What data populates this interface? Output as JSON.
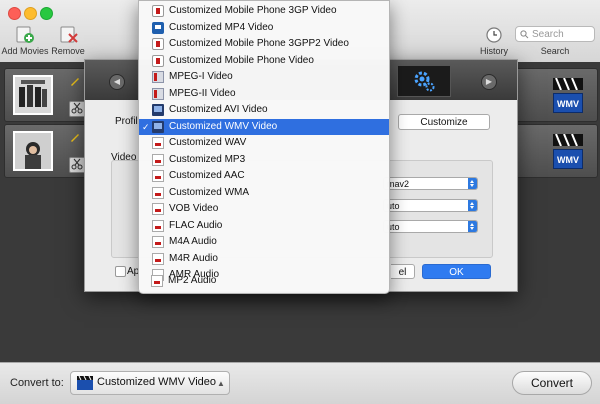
{
  "toolbar": {
    "add_movies_label": "Add Movies",
    "remove_label": "Remove",
    "history_label": "History",
    "search_label": "Search",
    "search_placeholder": "Search"
  },
  "dialog": {
    "profile_label": "Profile",
    "customize_label": "Customize",
    "video_label": "Video",
    "apply_label": "Ap",
    "cancel_label": "el",
    "ok_label": "OK",
    "select_values": [
      "mav2",
      "uto",
      "uto"
    ]
  },
  "profile_menu": {
    "selected_index": 7,
    "items": [
      {
        "label": "Customized Mobile Phone 3GP Video",
        "icon": "phone-icon"
      },
      {
        "label": "Customized MP4 Video",
        "icon": "mp4-icon"
      },
      {
        "label": "Customized Mobile Phone 3GPP2 Video",
        "icon": "phone-icon"
      },
      {
        "label": "Customized Mobile Phone Video",
        "icon": "phone-icon"
      },
      {
        "label": "MPEG-I Video",
        "icon": "mpeg-icon"
      },
      {
        "label": "MPEG-II Video",
        "icon": "mpeg-icon"
      },
      {
        "label": "Customized AVI Video",
        "icon": "film-icon"
      },
      {
        "label": "Customized WMV Video",
        "icon": "film-icon"
      },
      {
        "label": "Customized WAV",
        "icon": "audio-icon"
      },
      {
        "label": "Customized MP3",
        "icon": "audio-icon"
      },
      {
        "label": "Customized AAC",
        "icon": "audio-icon"
      },
      {
        "label": "Customized WMA",
        "icon": "audio-icon"
      },
      {
        "label": "VOB Video",
        "icon": "audio-icon"
      },
      {
        "label": "FLAC Audio",
        "icon": "audio-icon"
      },
      {
        "label": "M4A Audio",
        "icon": "audio-icon"
      },
      {
        "label": "M4R Audio",
        "icon": "audio-icon"
      },
      {
        "label": "AMR Audio",
        "icon": "audio-icon"
      },
      {
        "label": "MP2 Audio",
        "icon": "audio-icon"
      }
    ]
  },
  "movies": [
    {
      "badge": "WMV"
    },
    {
      "badge": "WMV"
    }
  ],
  "bottom": {
    "convert_to_label": "Convert to:",
    "format_value": "Customized WMV Video",
    "convert_label": "Convert"
  },
  "colors": {
    "accent": "#2f6fe0",
    "dark_bg": "#3d3d3d"
  }
}
